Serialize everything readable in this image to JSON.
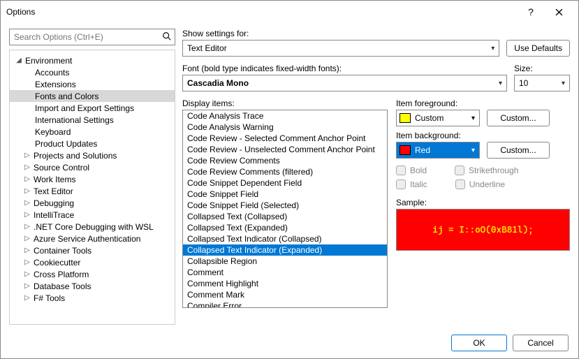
{
  "window": {
    "title": "Options"
  },
  "search": {
    "placeholder": "Search Options (Ctrl+E)"
  },
  "tree": {
    "root": "Environment",
    "env_children": [
      "Accounts",
      "Extensions",
      "Fonts and Colors",
      "Import and Export Settings",
      "International Settings",
      "Keyboard",
      "Product Updates"
    ],
    "env_selected": "Fonts and Colors",
    "siblings": [
      "Projects and Solutions",
      "Source Control",
      "Work Items",
      "Text Editor",
      "Debugging",
      "IntelliTrace",
      ".NET Core Debugging with WSL",
      "Azure Service Authentication",
      "Container Tools",
      "Cookiecutter",
      "Cross Platform",
      "Database Tools",
      "F# Tools"
    ]
  },
  "show_settings_label": "Show settings for:",
  "show_settings_value": "Text Editor",
  "use_defaults": "Use Defaults",
  "font_label": "Font (bold type indicates fixed-width fonts):",
  "font_value": "Cascadia Mono",
  "size_label": "Size:",
  "size_value": "10",
  "display_items_label": "Display items:",
  "display_items": [
    "Code Analysis Trace",
    "Code Analysis Warning",
    "Code Review - Selected Comment Anchor Point",
    "Code Review - Unselected Comment Anchor Point",
    "Code Review Comments",
    "Code Review Comments (filtered)",
    "Code Snippet Dependent Field",
    "Code Snippet Field",
    "Code Snippet Field (Selected)",
    "Collapsed Text (Collapsed)",
    "Collapsed Text (Expanded)",
    "Collapsed Text Indicator (Collapsed)",
    "Collapsed Text Indicator (Expanded)",
    "Collapsible Region",
    "Comment",
    "Comment Highlight",
    "Comment Mark",
    "Compiler Error"
  ],
  "display_selected": "Collapsed Text Indicator (Expanded)",
  "fg_label": "Item foreground:",
  "fg_value": "Custom",
  "fg_color": "#ffff00",
  "bg_label": "Item background:",
  "bg_value": "Red",
  "bg_color": "#ff0000",
  "custom_btn": "Custom...",
  "bold_label": "Bold",
  "italic_label": "Italic",
  "strike_label": "Strikethrough",
  "underline_label": "Underline",
  "sample_label": "Sample:",
  "sample_text": "ij = I::oO(0xB81l);",
  "ok": "OK",
  "cancel": "Cancel"
}
